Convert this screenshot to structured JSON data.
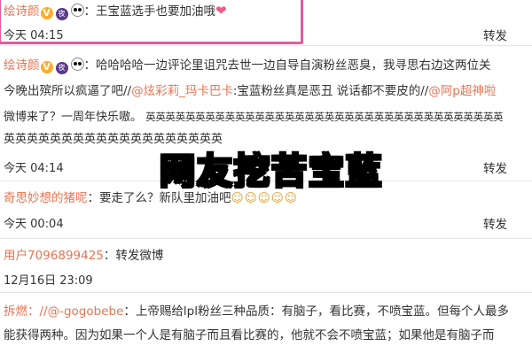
{
  "comments": [
    {
      "username": "绘诗颜",
      "badge_v": "V",
      "badge_icon": "夜",
      "text_prefix": "：王宝蓝选手也要加油哦",
      "time": "今天 04:15",
      "repost": "转发"
    },
    {
      "username": "绘诗颜",
      "badge_v": "V",
      "badge_icon": "夜",
      "line1": "：哈哈哈哈一边评论里诅咒去世一边自导自演粉丝恶臭，我寻思右边这两位关",
      "line2_a": "今晚出殡所以疯逼了吧//",
      "mention1": "@炫彩莉_玛卡巴卡",
      "line2_b": ":宝蓝粉丝真是恶丑  说话都不要皮的//",
      "mention2": "@阿p超神啦",
      "line3": "微博来了？一周年快乐嗷。",
      "repeat_chars_1": "英英英英英英英英英英英英英英英英英英英英英英英英英英英英英英英英英英英英",
      "repeat_chars_2": "英英英英英英英英英英英英英英英英英英英",
      "time": "今天 04:14",
      "repost": "转发"
    },
    {
      "username": "奇思妙想的猪呢",
      "text": "：要走了么？新队里加油吧",
      "laughs": "&#8203;",
      "time": "今天 00:04",
      "repost": "转发"
    },
    {
      "username": "用户7096899425",
      "text": "：转发微博",
      "time": "12月16日 23:09",
      "repost": "转发"
    },
    {
      "username": "拆燃",
      "mention": "：//@-gogobebe",
      "line1": "：上帝赐给lpl粉丝三种品质：有脑子，看比赛，不喷宝蓝。但每个人最多",
      "line2": "能获得两种。因为如果一个人是有脑子而且看比赛的，他就不会不喷宝蓝；如果他是有脑子而"
    }
  ],
  "overlay_title": "网友挖苦宝蓝",
  "colors": {
    "username": "#eb7350",
    "highlight_border": "#e85a9a",
    "overlay_fill": "#ffff00"
  }
}
